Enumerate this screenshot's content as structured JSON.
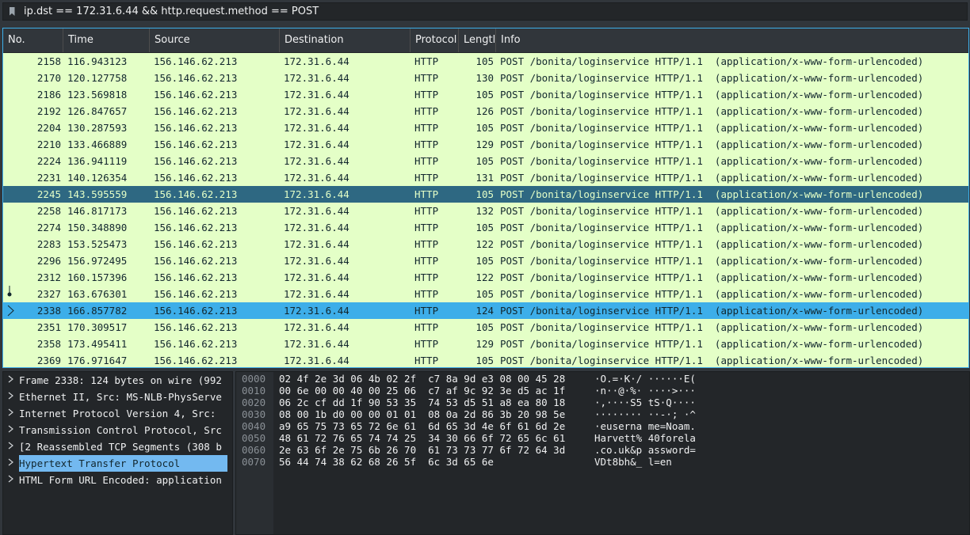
{
  "filter": {
    "value": "ip.dst == 172.31.6.44 && http.request.method == POST"
  },
  "colors": {
    "row_bg": "#e4ffc7",
    "row_text": "#12272e",
    "selected_dark": "#2e6882",
    "selected_bright": "#3daee9",
    "tree_selected": "#73b9f0"
  },
  "packet_list": {
    "columns": [
      "No.",
      "Time",
      "Source",
      "Destination",
      "Protocol",
      "Lengtl",
      "Info"
    ],
    "rows": [
      {
        "no": "2158",
        "time": "116.943123",
        "src": "156.146.62.213",
        "dst": "172.31.6.44",
        "proto": "HTTP",
        "len": "105",
        "info": "POST /bonita/loginservice HTTP/1.1  (application/x-www-form-urlencoded)"
      },
      {
        "no": "2170",
        "time": "120.127758",
        "src": "156.146.62.213",
        "dst": "172.31.6.44",
        "proto": "HTTP",
        "len": "130",
        "info": "POST /bonita/loginservice HTTP/1.1  (application/x-www-form-urlencoded)"
      },
      {
        "no": "2186",
        "time": "123.569818",
        "src": "156.146.62.213",
        "dst": "172.31.6.44",
        "proto": "HTTP",
        "len": "105",
        "info": "POST /bonita/loginservice HTTP/1.1  (application/x-www-form-urlencoded)"
      },
      {
        "no": "2192",
        "time": "126.847657",
        "src": "156.146.62.213",
        "dst": "172.31.6.44",
        "proto": "HTTP",
        "len": "126",
        "info": "POST /bonita/loginservice HTTP/1.1  (application/x-www-form-urlencoded)"
      },
      {
        "no": "2204",
        "time": "130.287593",
        "src": "156.146.62.213",
        "dst": "172.31.6.44",
        "proto": "HTTP",
        "len": "105",
        "info": "POST /bonita/loginservice HTTP/1.1  (application/x-www-form-urlencoded)"
      },
      {
        "no": "2210",
        "time": "133.466889",
        "src": "156.146.62.213",
        "dst": "172.31.6.44",
        "proto": "HTTP",
        "len": "129",
        "info": "POST /bonita/loginservice HTTP/1.1  (application/x-www-form-urlencoded)"
      },
      {
        "no": "2224",
        "time": "136.941119",
        "src": "156.146.62.213",
        "dst": "172.31.6.44",
        "proto": "HTTP",
        "len": "105",
        "info": "POST /bonita/loginservice HTTP/1.1  (application/x-www-form-urlencoded)"
      },
      {
        "no": "2231",
        "time": "140.126354",
        "src": "156.146.62.213",
        "dst": "172.31.6.44",
        "proto": "HTTP",
        "len": "131",
        "info": "POST /bonita/loginservice HTTP/1.1  (application/x-www-form-urlencoded)"
      },
      {
        "no": "2245",
        "time": "143.595559",
        "src": "156.146.62.213",
        "dst": "172.31.6.44",
        "proto": "HTTP",
        "len": "105",
        "info": "POST /bonita/loginservice HTTP/1.1  (application/x-www-form-urlencoded)",
        "state": "sel-dark"
      },
      {
        "no": "2258",
        "time": "146.817173",
        "src": "156.146.62.213",
        "dst": "172.31.6.44",
        "proto": "HTTP",
        "len": "132",
        "info": "POST /bonita/loginservice HTTP/1.1  (application/x-www-form-urlencoded)"
      },
      {
        "no": "2274",
        "time": "150.348890",
        "src": "156.146.62.213",
        "dst": "172.31.6.44",
        "proto": "HTTP",
        "len": "105",
        "info": "POST /bonita/loginservice HTTP/1.1  (application/x-www-form-urlencoded)"
      },
      {
        "no": "2283",
        "time": "153.525473",
        "src": "156.146.62.213",
        "dst": "172.31.6.44",
        "proto": "HTTP",
        "len": "122",
        "info": "POST /bonita/loginservice HTTP/1.1  (application/x-www-form-urlencoded)"
      },
      {
        "no": "2296",
        "time": "156.972495",
        "src": "156.146.62.213",
        "dst": "172.31.6.44",
        "proto": "HTTP",
        "len": "105",
        "info": "POST /bonita/loginservice HTTP/1.1  (application/x-www-form-urlencoded)"
      },
      {
        "no": "2312",
        "time": "160.157396",
        "src": "156.146.62.213",
        "dst": "172.31.6.44",
        "proto": "HTTP",
        "len": "122",
        "info": "POST /bonita/loginservice HTTP/1.1  (application/x-www-form-urlencoded)"
      },
      {
        "no": "2327",
        "time": "163.676301",
        "src": "156.146.62.213",
        "dst": "172.31.6.44",
        "proto": "HTTP",
        "len": "105",
        "info": "POST /bonita/loginservice HTTP/1.1  (application/x-www-form-urlencoded)",
        "marker": "related"
      },
      {
        "no": "2338",
        "time": "166.857782",
        "src": "156.146.62.213",
        "dst": "172.31.6.44",
        "proto": "HTTP",
        "len": "124",
        "info": "POST /bonita/loginservice HTTP/1.1  (application/x-www-form-urlencoded)",
        "state": "sel-bright",
        "marker": "current"
      },
      {
        "no": "2351",
        "time": "170.309517",
        "src": "156.146.62.213",
        "dst": "172.31.6.44",
        "proto": "HTTP",
        "len": "105",
        "info": "POST /bonita/loginservice HTTP/1.1  (application/x-www-form-urlencoded)"
      },
      {
        "no": "2358",
        "time": "173.495411",
        "src": "156.146.62.213",
        "dst": "172.31.6.44",
        "proto": "HTTP",
        "len": "129",
        "info": "POST /bonita/loginservice HTTP/1.1  (application/x-www-form-urlencoded)"
      },
      {
        "no": "2369",
        "time": "176.971647",
        "src": "156.146.62.213",
        "dst": "172.31.6.44",
        "proto": "HTTP",
        "len": "105",
        "info": "POST /bonita/loginservice HTTP/1.1  (application/x-www-form-urlencoded)"
      }
    ]
  },
  "detail_tree": {
    "items": [
      {
        "label": "Frame 2338: 124 bytes on wire (992"
      },
      {
        "label": "Ethernet II, Src: MS-NLB-PhysServe"
      },
      {
        "label": "Internet Protocol Version 4, Src: "
      },
      {
        "label": "Transmission Control Protocol, Src"
      },
      {
        "label": "[2 Reassembled TCP Segments (308 b"
      },
      {
        "label": "Hypertext Transfer Protocol",
        "selected": true
      },
      {
        "label": "HTML Form URL Encoded: application"
      }
    ]
  },
  "bytes_pane": {
    "rows": [
      {
        "offset": "0000",
        "hex": "02 4f 2e 3d 06 4b 02 2f  c7 8a 9d e3 08 00 45 28",
        "ascii": "·O.=·K·/ ······E("
      },
      {
        "offset": "0010",
        "hex": "00 6e 00 00 40 00 25 06  c7 af 9c 92 3e d5 ac 1f",
        "ascii": "·n··@·%· ····>···"
      },
      {
        "offset": "0020",
        "hex": "06 2c cf dd 1f 90 53 35  74 53 d5 51 a8 ea 80 18",
        "ascii": "·,····S5 tS·Q····"
      },
      {
        "offset": "0030",
        "hex": "08 00 1b d0 00 00 01 01  08 0a 2d 86 3b 20 98 5e",
        "ascii": "········ ··-·; ·^"
      },
      {
        "offset": "0040",
        "hex": "a9 65 75 73 65 72 6e 61  6d 65 3d 4e 6f 61 6d 2e",
        "ascii": "·euserna me=Noam."
      },
      {
        "offset": "0050",
        "hex": "48 61 72 76 65 74 74 25  34 30 66 6f 72 65 6c 61",
        "ascii": "Harvett% 40forela"
      },
      {
        "offset": "0060",
        "hex": "2e 63 6f 2e 75 6b 26 70  61 73 73 77 6f 72 64 3d",
        "ascii": ".co.uk&p assword="
      },
      {
        "offset": "0070",
        "hex": "56 44 74 38 62 68 26 5f  6c 3d 65 6e",
        "ascii": "VDt8bh&_ l=en"
      }
    ]
  }
}
